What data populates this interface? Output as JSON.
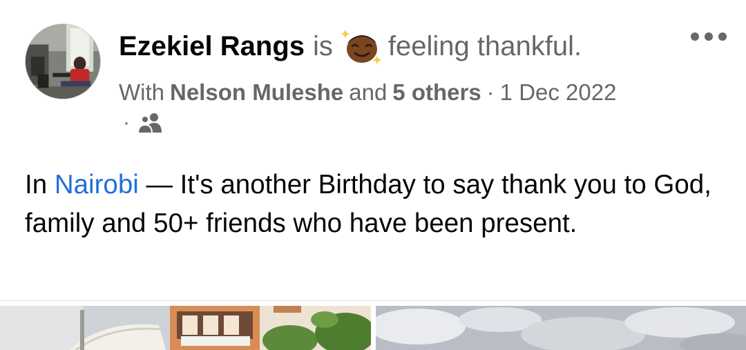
{
  "post": {
    "author": "Ezekiel Rangs",
    "is_word": "is",
    "feeling_icon": "star-struck-face-emoji",
    "feeling": "feeling thankful.",
    "with_prefix": "With",
    "tagged_person": "Nelson Muleshe",
    "and_word": "and",
    "others": "5 others",
    "separator": "·",
    "date": "1 Dec 2022",
    "audience_separator": "·",
    "audience_icon": "friends-icon",
    "more_icon": "more-options-icon",
    "text_prefix": "In",
    "location": "Nairobi",
    "text_body": " — It's another Birthday to say thank you to God, family and 50+ friends who have been present."
  },
  "colors": {
    "link": "#216fdb",
    "secondary_text": "#65676b",
    "primary_text": "#050505"
  }
}
